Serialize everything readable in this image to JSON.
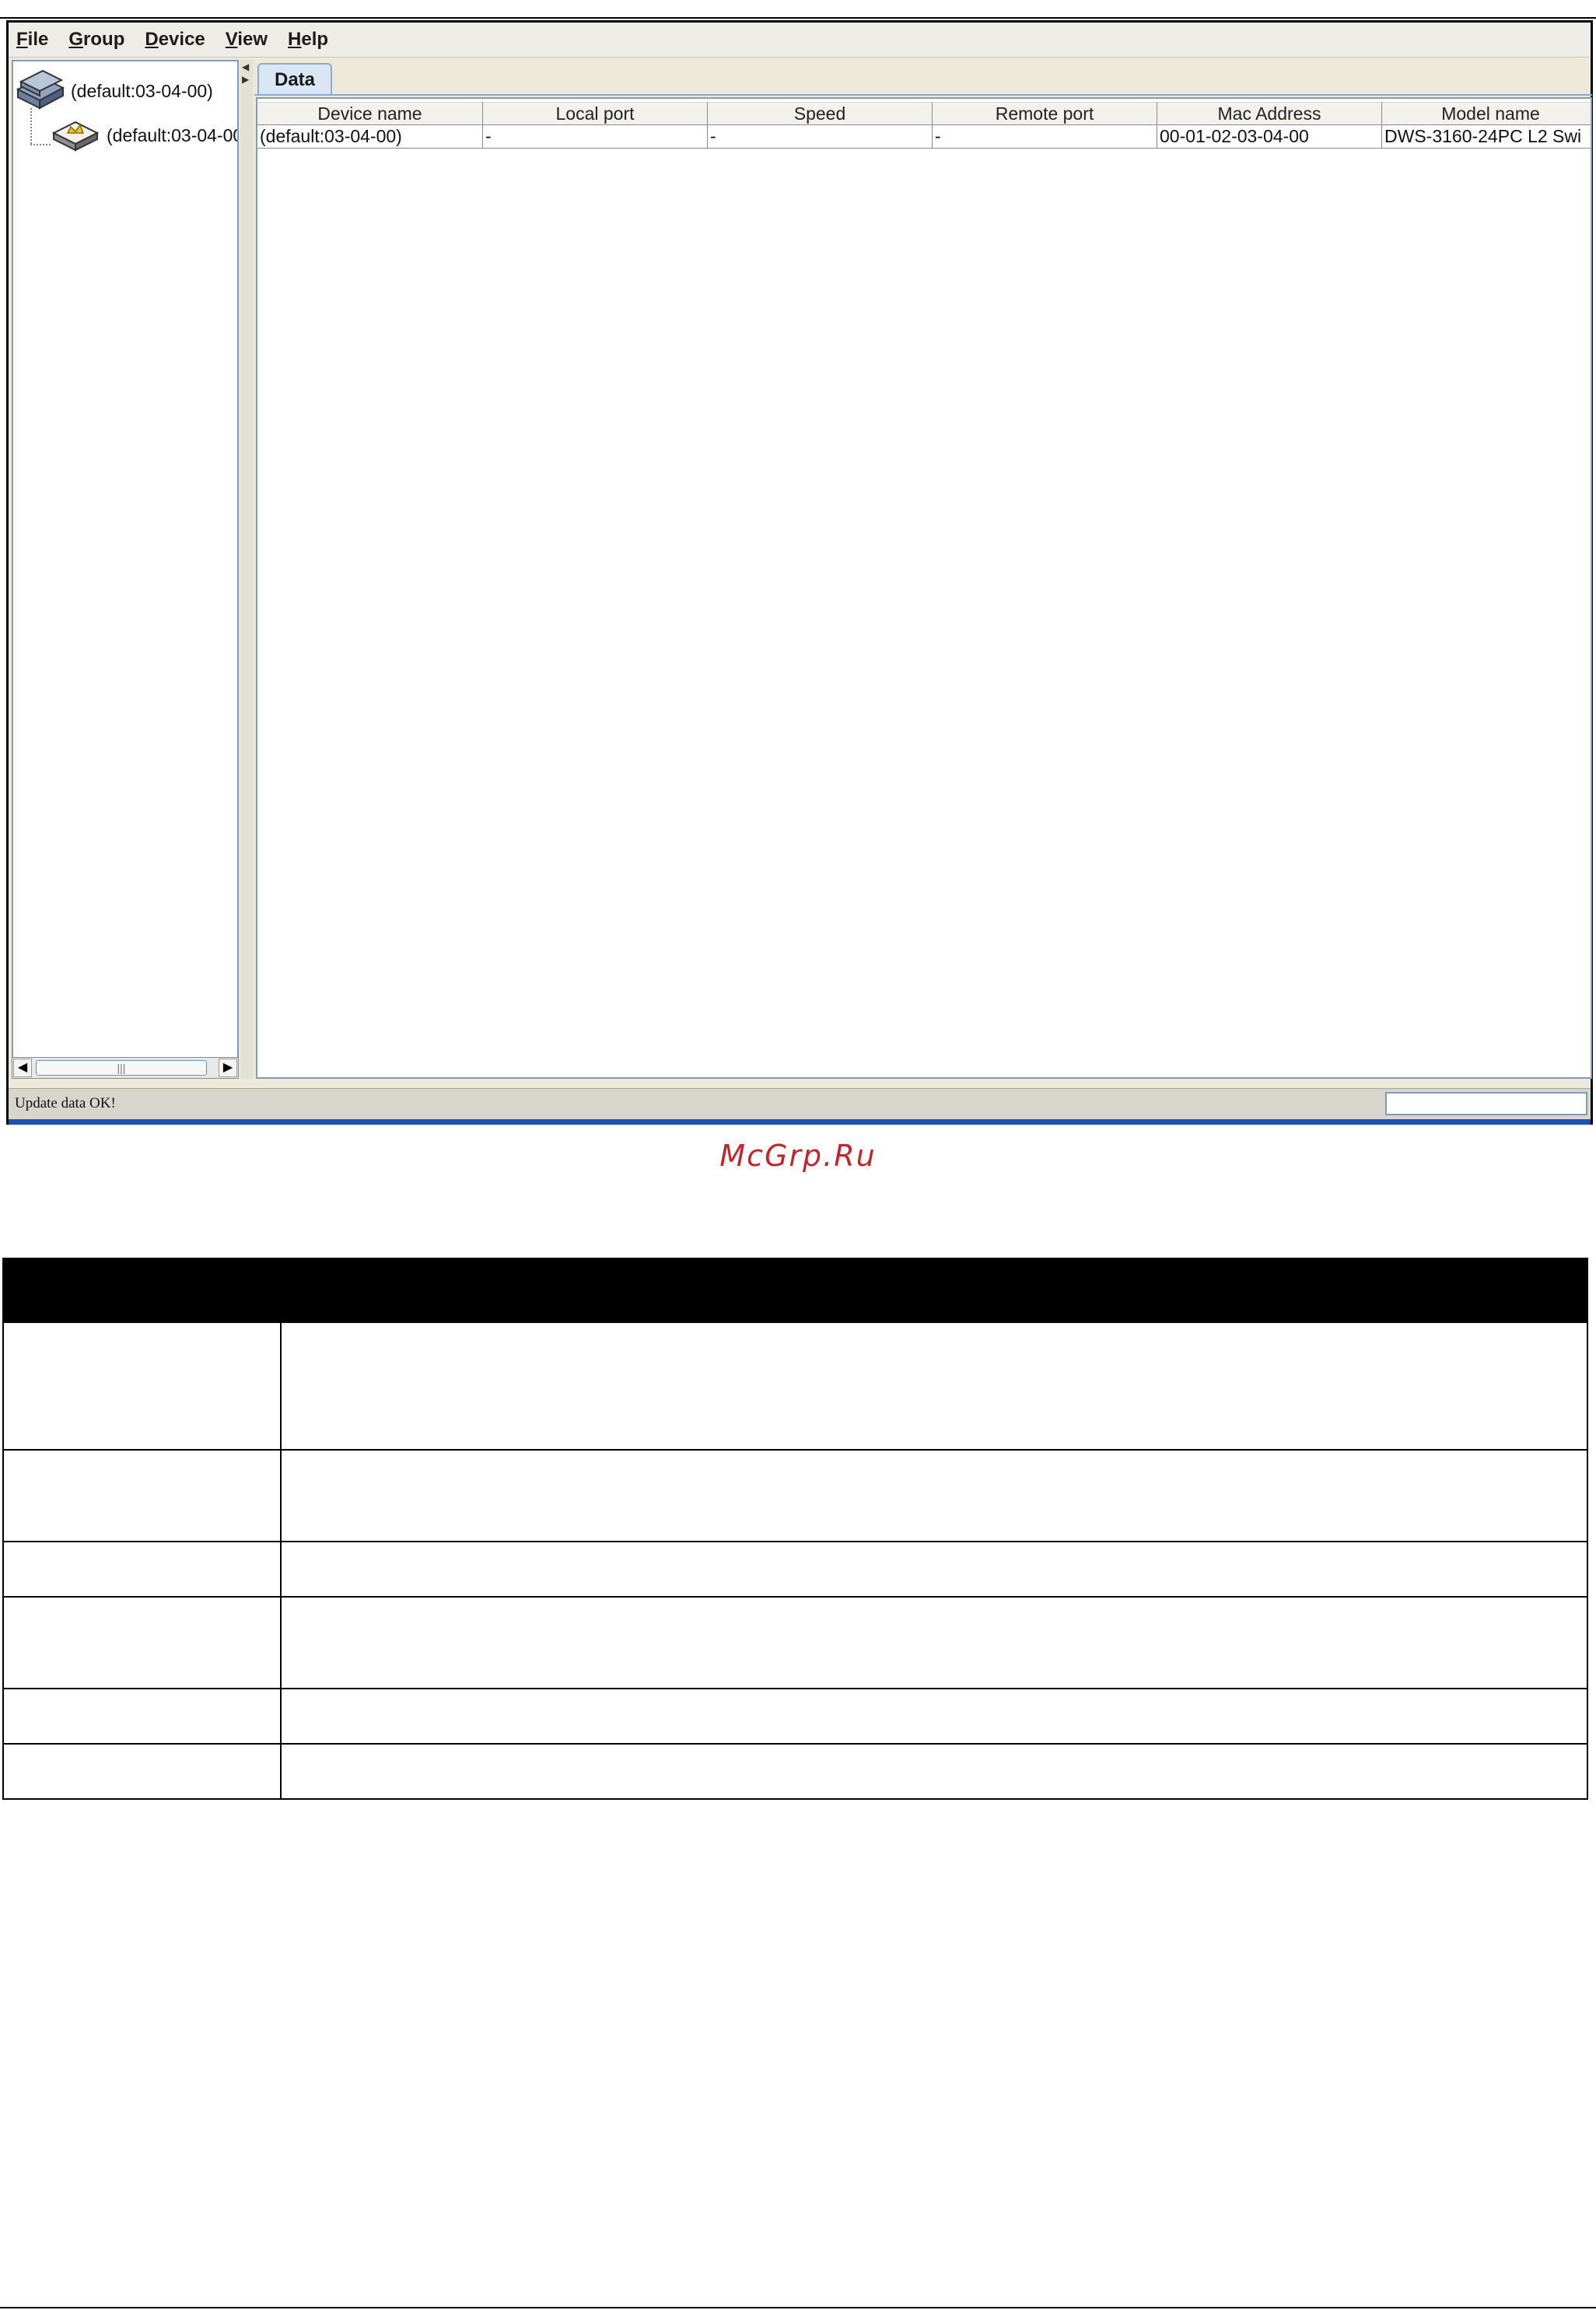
{
  "menu": [
    "File",
    "Group",
    "Device",
    "View",
    "Help"
  ],
  "menu_mnemonics": [
    "F",
    "G",
    "D",
    "V",
    "H"
  ],
  "tree": {
    "root_label": "(default:03-04-00)",
    "child_label": "(default:03-04-00"
  },
  "tab_label": "Data",
  "table": {
    "columns": [
      "Device name",
      "Local port",
      "Speed",
      "Remote port",
      "Mac Address",
      "Model name"
    ],
    "rows": [
      [
        "(default:03-04-00)",
        "-",
        "-",
        "-",
        "00-01-02-03-04-00",
        "DWS-3160-24PC L2 Swi"
      ]
    ]
  },
  "status": {
    "message": "Update data OK!"
  },
  "watermark": "McGrp.Ru",
  "doc_table": {
    "rows": [
      [
        "",
        ""
      ],
      [
        "",
        ""
      ],
      [
        "",
        ""
      ],
      [
        "",
        ""
      ],
      [
        "",
        ""
      ],
      [
        "",
        ""
      ],
      [
        "",
        ""
      ]
    ]
  }
}
